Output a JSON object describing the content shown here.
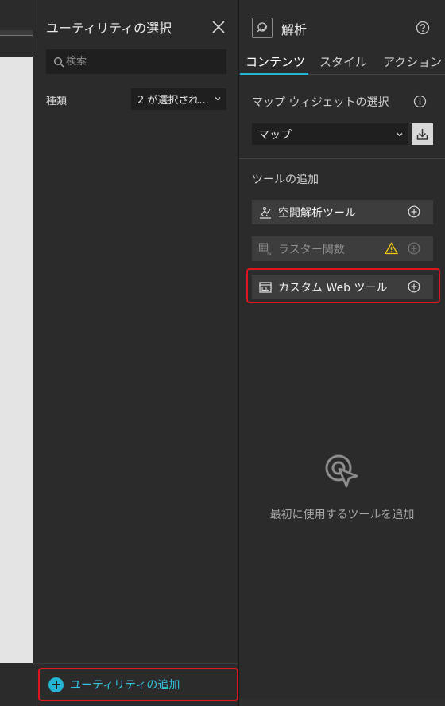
{
  "utility_panel": {
    "title": "ユーティリティの選択",
    "search_placeholder": "検索",
    "type_label": "種類",
    "type_value": "2 が選択され...",
    "add_utility_label": "ユーティリティの追加",
    "accent_color": "#23b5d3"
  },
  "analysis_panel": {
    "title": "解析",
    "tabs": [
      {
        "label": "コンテンツ",
        "active": true
      },
      {
        "label": "スタイル",
        "active": false
      },
      {
        "label": "アクション",
        "active": false
      }
    ],
    "map_widget_label": "マップ ウィジェットの選択",
    "map_value": "マップ",
    "tools_label": "ツールの追加",
    "tools": [
      {
        "label": "空間解析ツール",
        "icon": "spatial-analysis-icon",
        "disabled": false,
        "warning": false
      },
      {
        "label": "ラスター関数",
        "icon": "raster-function-icon",
        "disabled": true,
        "warning": true
      },
      {
        "label": "カスタム Web ツール",
        "icon": "custom-web-tool-icon",
        "disabled": false,
        "warning": false
      }
    ],
    "empty_message": "最初に使用するツールを追加"
  },
  "highlight_color": "#e0161d"
}
